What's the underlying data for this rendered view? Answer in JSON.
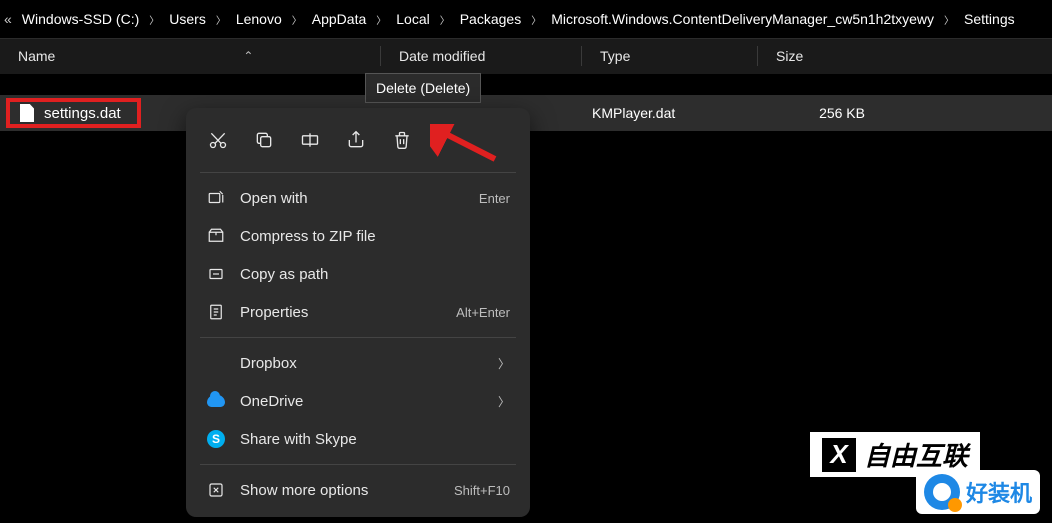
{
  "breadcrumb": {
    "prefix": "«",
    "items": [
      "Windows-SSD (C:)",
      "Users",
      "Lenovo",
      "AppData",
      "Local",
      "Packages",
      "Microsoft.Windows.ContentDeliveryManager_cw5n1h2txyewy",
      "Settings"
    ]
  },
  "columns": {
    "name": "Name",
    "date": "Date modified",
    "type": "Type",
    "size": "Size"
  },
  "file": {
    "name": "settings.dat",
    "type": "KMPlayer.dat",
    "size": "256 KB"
  },
  "tooltip": "Delete (Delete)",
  "ctx": {
    "open_with": "Open with",
    "open_with_short": "Enter",
    "compress": "Compress to ZIP file",
    "copy_path": "Copy as path",
    "properties": "Properties",
    "properties_short": "Alt+Enter",
    "dropbox": "Dropbox",
    "onedrive": "OneDrive",
    "skype": "Share with Skype",
    "show_more": "Show more options",
    "show_more_short": "Shift+F10"
  },
  "watermark1": "自由互联",
  "watermark2": "好装机"
}
